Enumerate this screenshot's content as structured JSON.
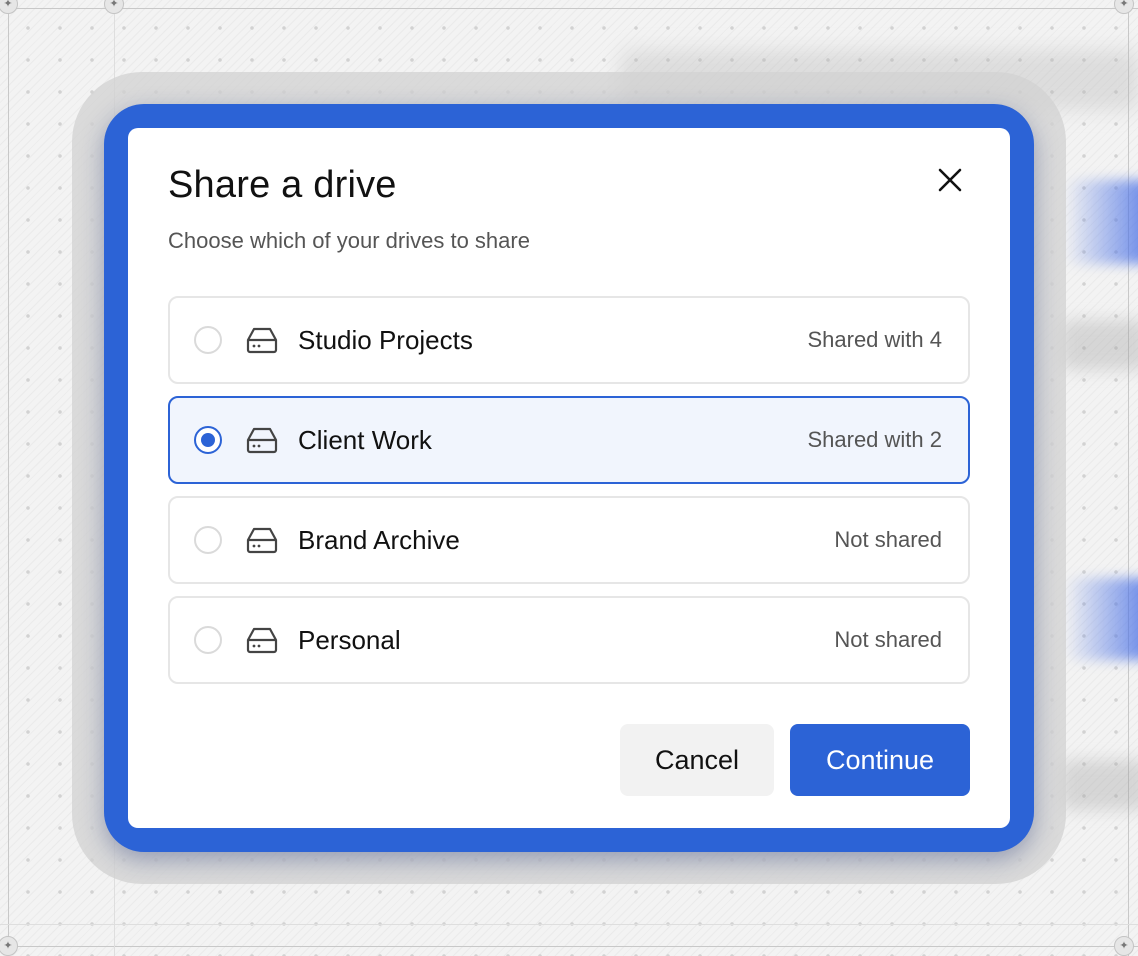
{
  "dialog": {
    "title": "Share a drive",
    "subtitle": "Choose which of your drives to share",
    "close_icon": "close-icon"
  },
  "drives": [
    {
      "name": "Studio Projects",
      "status": "Shared with 4",
      "selected": false,
      "icon": "drive-icon"
    },
    {
      "name": "Client Work",
      "status": "Shared with 2",
      "selected": true,
      "icon": "drive-icon"
    },
    {
      "name": "Brand Archive",
      "status": "Not shared",
      "selected": false,
      "icon": "drive-icon"
    },
    {
      "name": "Personal",
      "status": "Not shared",
      "selected": false,
      "icon": "drive-icon"
    }
  ],
  "actions": {
    "cancel_label": "Cancel",
    "continue_label": "Continue"
  },
  "colors": {
    "accent": "#2c63d6",
    "selected_bg": "#f1f5fd",
    "border": "#e6e6e6"
  }
}
